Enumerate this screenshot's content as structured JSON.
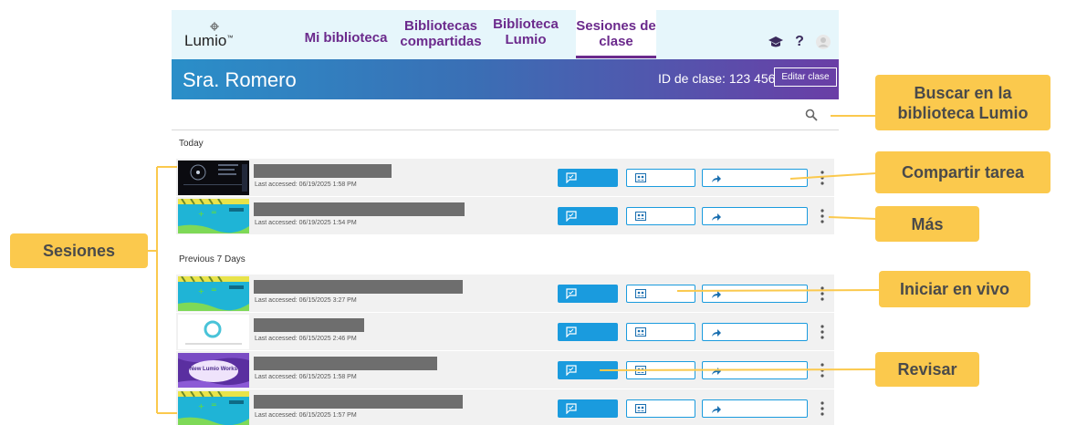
{
  "app": {
    "logo": "Lumio",
    "nav": [
      {
        "label": "Mi biblioteca"
      },
      {
        "label": "Bibliotecas compartidas"
      },
      {
        "label": "Biblioteca Lumio"
      },
      {
        "label": "Sesiones de clase",
        "active": true
      }
    ],
    "icons": [
      "graduation-cap-icon",
      "help-icon",
      "avatar-icon"
    ],
    "help_label": "?"
  },
  "class": {
    "name": "Sra. Romero",
    "id_text": "ID de clase: 123 456",
    "edit_label": "Editar clase"
  },
  "sections": [
    {
      "label": "Today",
      "rows": [
        {
          "accessed": "Last accessed: 06/19/2025 1:58 PM",
          "thumb": "dark"
        },
        {
          "accessed": "Last accessed: 06/19/2025 1:54 PM",
          "thumb": "teal"
        }
      ]
    },
    {
      "label": "Previous 7 Days",
      "rows": [
        {
          "accessed": "Last accessed: 06/15/2025 3:27 PM",
          "thumb": "teal"
        },
        {
          "accessed": "Last accessed: 06/15/2025 2:46 PM",
          "thumb": "ring"
        },
        {
          "accessed": "Last accessed: 06/15/2025 1:58 PM",
          "thumb": "purple",
          "thumb_text": "New Lumio Works"
        },
        {
          "accessed": "Last accessed: 06/15/2025 1:57 PM",
          "thumb": "teal"
        }
      ]
    }
  ],
  "callouts": {
    "search": "Buscar en la biblioteca Lumio",
    "share": "Compartir tarea",
    "more": "Más",
    "live": "Iniciar en vivo",
    "review": "Revisar",
    "sessions": "Sesiones"
  },
  "colors": {
    "accent": "#1a9bde",
    "nav_text": "#6b2a8c",
    "callout": "#fbc94d"
  }
}
